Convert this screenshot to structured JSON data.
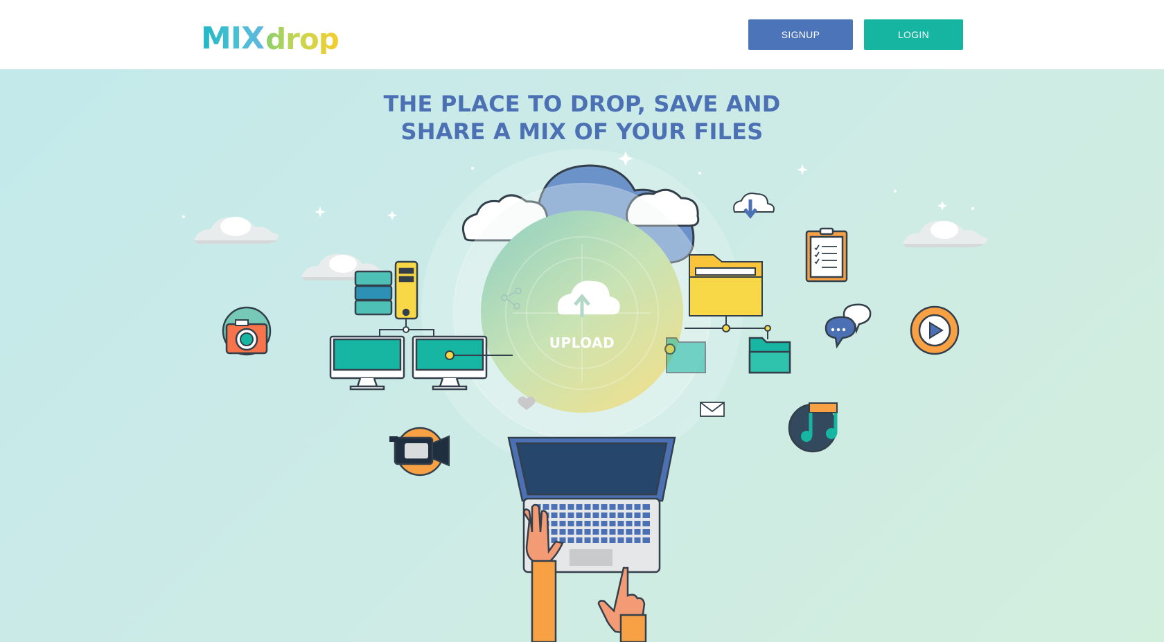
{
  "header": {
    "logo": {
      "part1": "MIX",
      "part2": "drop"
    },
    "signup_label": "SIGNUP",
    "login_label": "LOGIN"
  },
  "hero": {
    "headline_line1": "THE PLACE TO DROP, SAVE AND",
    "headline_line2": "SHARE A MIX OF YOUR FILES",
    "upload_label": "UPLOAD"
  },
  "colors": {
    "signup": "#4c74b9",
    "login": "#15b5a2",
    "headline": "#4b70b4",
    "teal": "#17b6a3",
    "orange": "#f7a044",
    "yellow": "#f9d848"
  },
  "icons": [
    "upload-cloud-icon",
    "camera-icon",
    "server-icon",
    "monitor-icon",
    "folder-icon",
    "clipboard-icon",
    "chat-icon",
    "play-icon",
    "music-icon",
    "video-camera-icon",
    "mail-icon",
    "heart-icon",
    "share-icon",
    "download-cloud-icon",
    "laptop-icon"
  ]
}
